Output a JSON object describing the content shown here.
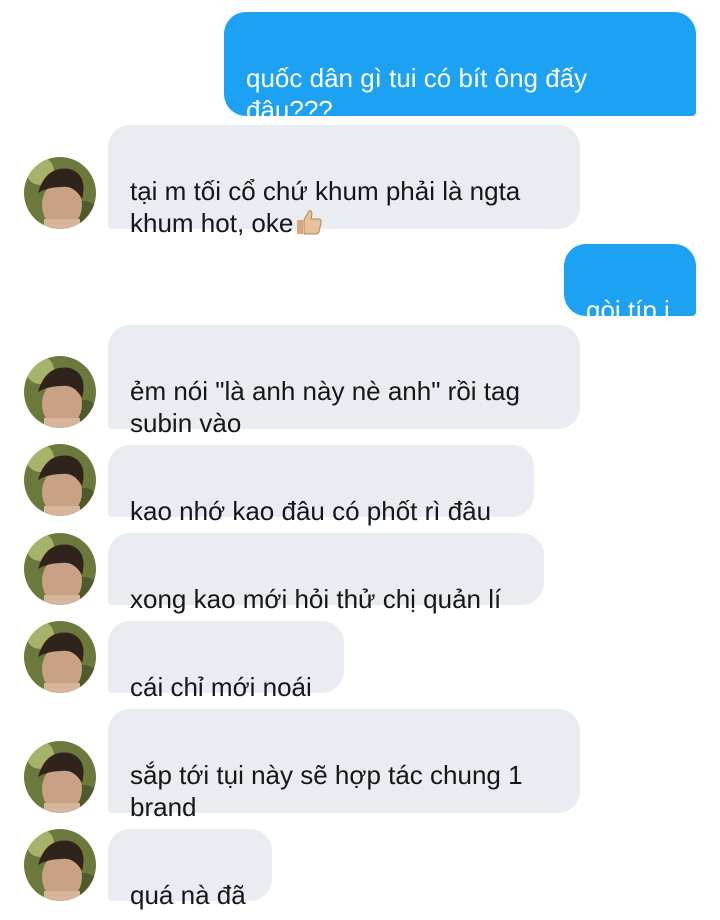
{
  "messages": [
    {
      "side": "out",
      "text": "quốc dân gì tui có bít ông đấy\nđâu???"
    },
    {
      "side": "in",
      "text": "tại m tối cổ chứ khum phải là ngta\nkhum hot, oke",
      "emoji": "thumbs-up-icon"
    },
    {
      "side": "out",
      "text": "gòi típ i"
    },
    {
      "side": "in",
      "text": "ẻm nói \"là anh này nè anh\" rồi tag\nsubin vào"
    },
    {
      "side": "in",
      "text": "kao nhớ kao đâu có phốt rì đâu"
    },
    {
      "side": "in",
      "text": "xong kao mới hỏi thử chị quản lí"
    },
    {
      "side": "in",
      "text": "cái chỉ mới noái"
    },
    {
      "side": "in",
      "text": "sắp tới tụi này sẽ hợp tác chung 1\nbrand"
    },
    {
      "side": "in",
      "text": "quá nà đã"
    }
  ],
  "colors": {
    "outgoing_bubble": "#1da1f2",
    "incoming_bubble": "#e9edf1",
    "outgoing_text": "#ffffff",
    "incoming_text": "#14171a"
  }
}
